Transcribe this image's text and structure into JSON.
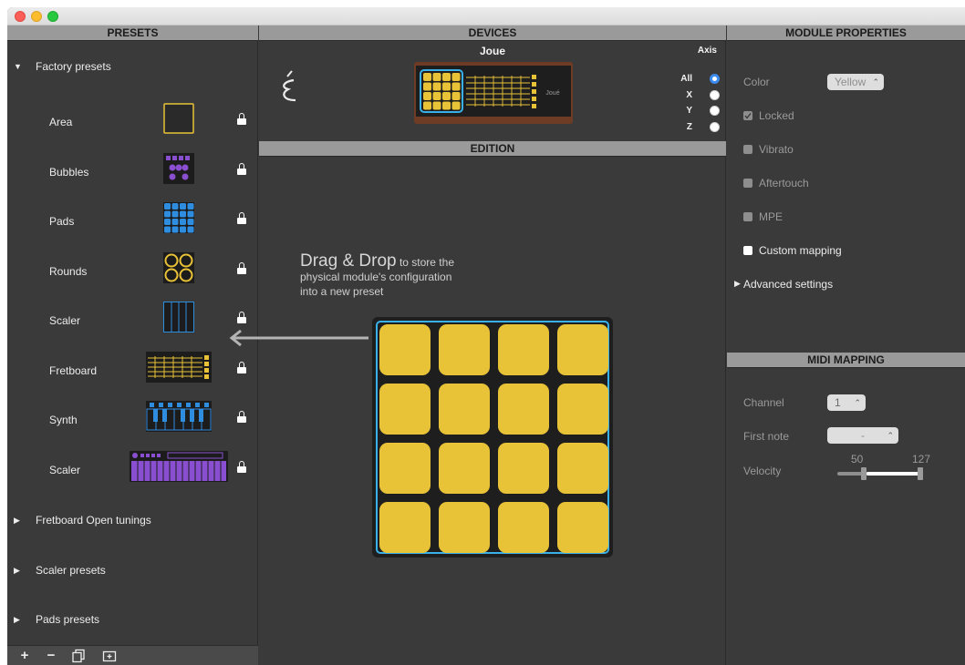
{
  "window": {
    "colors": {
      "background": "#3a3a3a",
      "header": "#9a9a9a",
      "pad_yellow": "#e8c237",
      "highlight_blue": "#3ab0e8"
    }
  },
  "presets": {
    "header": "PRESETS",
    "factory_group": {
      "label": "Factory presets",
      "expanded": true
    },
    "items": [
      {
        "label": "Area",
        "thumb": "area"
      },
      {
        "label": "Bubbles",
        "thumb": "bubbles"
      },
      {
        "label": "Pads",
        "thumb": "pads"
      },
      {
        "label": "Rounds",
        "thumb": "rounds"
      },
      {
        "label": "Scaler",
        "thumb": "scaler"
      },
      {
        "label": "Fretboard",
        "thumb": "fretboard"
      },
      {
        "label": "Synth",
        "thumb": "synth"
      },
      {
        "label": "Scaler",
        "thumb": "scaler-keys"
      }
    ],
    "other_groups": [
      {
        "label": "Fretboard Open tunings"
      },
      {
        "label": "Scaler presets"
      },
      {
        "label": "Pads presets"
      }
    ],
    "toolbar": {
      "add": "+",
      "remove": "−"
    }
  },
  "devices": {
    "header": "DEVICES",
    "device_name": "Joue",
    "axis": {
      "title": "Axis",
      "options": [
        "All",
        "X",
        "Y",
        "Z"
      ],
      "selected": "All"
    },
    "board_brand": "Joué"
  },
  "edition": {
    "header": "EDITION",
    "drag_title": "Drag & Drop",
    "drag_text_1": "to store the",
    "drag_text_2": "physical module's configuration",
    "drag_text_3": "into a new preset",
    "pad_rows": 4,
    "pad_cols": 4
  },
  "module_properties": {
    "header": "MODULE PROPERTIES",
    "color_label": "Color",
    "color_value": "Yellow",
    "locked": {
      "label": "Locked",
      "checked": true
    },
    "vibrato": {
      "label": "Vibrato",
      "checked": false
    },
    "aftertouch": {
      "label": "Aftertouch",
      "checked": false
    },
    "mpe": {
      "label": "MPE",
      "checked": false
    },
    "custom_mapping": {
      "label": "Custom mapping",
      "checked": false
    },
    "advanced": "Advanced settings"
  },
  "midi_mapping": {
    "header": "MIDI MAPPING",
    "channel_label": "Channel",
    "channel_value": "1",
    "first_note_label": "First note",
    "first_note_value": "-",
    "velocity_label": "Velocity",
    "velocity_min": "50",
    "velocity_max": "127"
  }
}
